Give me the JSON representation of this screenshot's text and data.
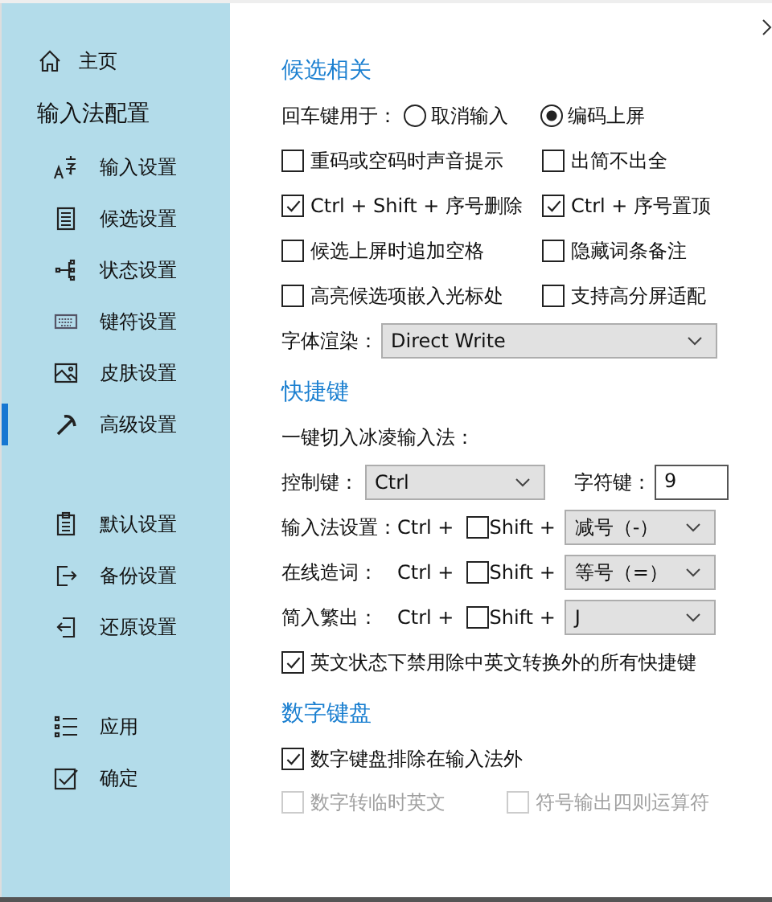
{
  "sidebar": {
    "home": {
      "label": "主页"
    },
    "section_title": "输入法配置",
    "nav_items": [
      {
        "label": "输入设置",
        "selected": false
      },
      {
        "label": "候选设置",
        "selected": false
      },
      {
        "label": "状态设置",
        "selected": false
      },
      {
        "label": "键符设置",
        "selected": false
      },
      {
        "label": "皮肤设置",
        "selected": false
      },
      {
        "label": "高级设置",
        "selected": true
      }
    ],
    "backup_items": [
      {
        "label": "默认设置"
      },
      {
        "label": "备份设置"
      },
      {
        "label": "还原设置"
      }
    ],
    "action_items": [
      {
        "label": "应用"
      },
      {
        "label": "确定"
      }
    ]
  },
  "candidates": {
    "title": "候选相关",
    "enter_key": {
      "label": "回车键用于：",
      "options": [
        {
          "label": "取消输入",
          "selected": false
        },
        {
          "label": "编码上屏",
          "selected": true
        }
      ]
    },
    "checkboxes": [
      {
        "label": "重码或空码时声音提示",
        "checked": false
      },
      {
        "label": "出简不出全",
        "checked": false
      },
      {
        "label": "Ctrl + Shift + 序号删除",
        "checked": true
      },
      {
        "label": "Ctrl + 序号置顶",
        "checked": true
      },
      {
        "label": "候选上屏时追加空格",
        "checked": false
      },
      {
        "label": "隐藏词条备注",
        "checked": false
      },
      {
        "label": "高亮候选项嵌入光标处",
        "checked": false
      },
      {
        "label": "支持高分屏适配",
        "checked": false
      }
    ],
    "font_render": {
      "label": "字体渲染：",
      "value": "Direct Write"
    }
  },
  "shortcuts": {
    "title": "快捷键",
    "switch_label": "一键切入冰凌输入法：",
    "control_key": {
      "label": "控制键：",
      "value": "Ctrl"
    },
    "char_key": {
      "label": "字符键：",
      "value": "9"
    },
    "hotkeys": [
      {
        "label": "输入法设置：",
        "ctrl": "Ctrl +",
        "shift_label": "Shift +",
        "shift_checked": false,
        "value": "减号（-）"
      },
      {
        "label": "在线造词：",
        "ctrl": "Ctrl +",
        "shift_label": "Shift +",
        "shift_checked": false,
        "value": "等号（=）"
      },
      {
        "label": "简入繁出：",
        "ctrl": "Ctrl +",
        "shift_label": "Shift +",
        "shift_checked": false,
        "value": "J"
      }
    ],
    "disable_checkbox": {
      "label": "英文状态下禁用除中英文转换外的所有快捷键",
      "checked": true
    }
  },
  "numpad": {
    "title": "数字键盘",
    "exclude": {
      "label": "数字键盘排除在输入法外",
      "checked": true
    },
    "sub_options": [
      {
        "label": "数字转临时英文",
        "checked": false,
        "disabled": true
      },
      {
        "label": "符号输出四则运算符",
        "checked": false,
        "disabled": true
      }
    ]
  }
}
